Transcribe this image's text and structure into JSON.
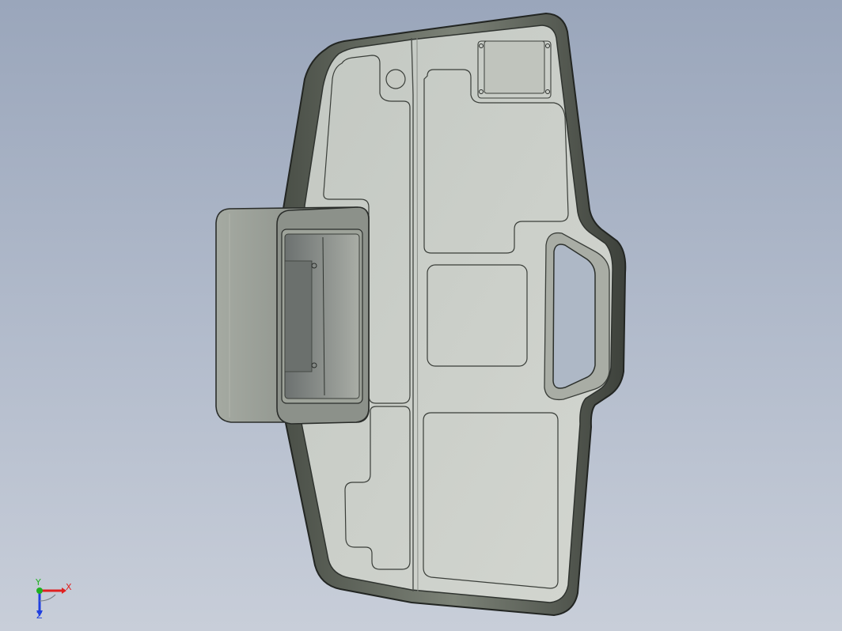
{
  "viewport": {
    "background_top": "#9aa6bb",
    "background_bottom": "#c8ced9"
  },
  "model": {
    "body_color": "#cfd3cd",
    "edge_color": "#2c302c",
    "rim_color": "#6f7569",
    "box_color": "#8f948d"
  },
  "triad": {
    "x_label": "X",
    "y_label": "Y",
    "z_label": "Z",
    "x_color": "#e02020",
    "y_color": "#20b020",
    "z_color": "#2040e0"
  }
}
